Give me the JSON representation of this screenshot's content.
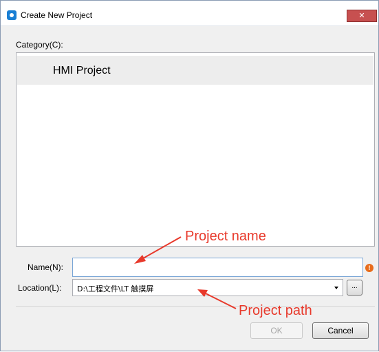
{
  "window": {
    "title": "Create New Project",
    "close_glyph": "✕"
  },
  "category": {
    "label": "Category(C):",
    "items": [
      "HMI Project"
    ]
  },
  "name_field": {
    "label": "Name(N):",
    "value": "",
    "error_glyph": "!"
  },
  "location_field": {
    "label": "Location(L):",
    "value": "D:\\工程文件\\LT 触摸屏",
    "browse_label": "..."
  },
  "buttons": {
    "ok": "OK",
    "cancel": "Cancel"
  },
  "annotations": {
    "project_name": "Project name",
    "project_path": "Project path"
  },
  "colors": {
    "annotation": "#e8392b",
    "error_icon": "#e86c1b",
    "app_icon": "#1a7fd4"
  }
}
